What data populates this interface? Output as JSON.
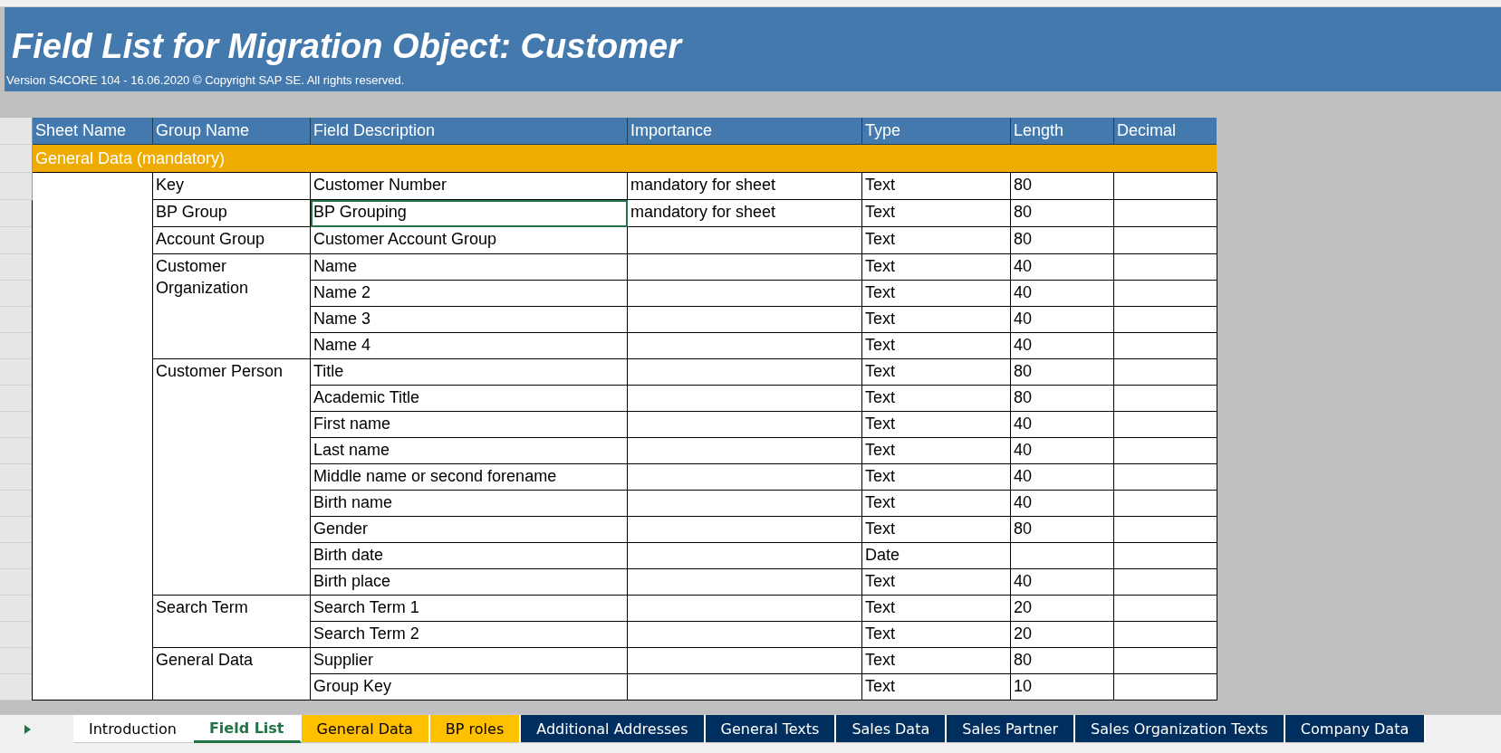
{
  "title": "Field List for Migration Object: Customer",
  "subtitle": "Version S4CORE 104  - 16.06.2020 © Copyright SAP SE. All rights reserved.",
  "columns": [
    "Sheet Name",
    "Group Name",
    "Field Description",
    "Importance",
    "Type",
    "Length",
    "Decimal"
  ],
  "section": "General Data (mandatory)",
  "groups": [
    {
      "name": "Key",
      "fields": [
        {
          "description": "Customer Number",
          "importance": "mandatory for sheet",
          "type": "Text",
          "length": "80",
          "selected": false
        }
      ]
    },
    {
      "name": "BP Group",
      "fields": [
        {
          "description": "BP Grouping",
          "importance": "mandatory for sheet",
          "type": "Text",
          "length": "80",
          "selected": true
        }
      ]
    },
    {
      "name": "Account Group",
      "fields": [
        {
          "description": "Customer Account Group",
          "type": "Text",
          "length": "80",
          "selected": false
        }
      ]
    },
    {
      "name": "Customer Organization",
      "fields": [
        {
          "description": "Name",
          "type": "Text",
          "length": "40",
          "selected": false
        },
        {
          "description": "Name 2",
          "type": "Text",
          "length": "40",
          "selected": false
        },
        {
          "description": "Name 3",
          "type": "Text",
          "length": "40",
          "selected": false
        },
        {
          "description": "Name 4",
          "type": "Text",
          "length": "40",
          "selected": false
        }
      ]
    },
    {
      "name": "Customer Person",
      "fields": [
        {
          "description": "Title",
          "type": "Text",
          "length": "80",
          "selected": false
        },
        {
          "description": "Academic Title",
          "type": "Text",
          "length": "80",
          "selected": false
        },
        {
          "description": "First name",
          "type": "Text",
          "length": "40",
          "selected": false
        },
        {
          "description": "Last name",
          "type": "Text",
          "length": "40",
          "selected": false
        },
        {
          "description": "Middle name or second forename",
          "type": "Text",
          "length": "40",
          "selected": false
        },
        {
          "description": "Birth name",
          "type": "Text",
          "length": "40",
          "selected": false
        },
        {
          "description": "Gender",
          "type": "Text",
          "length": "80",
          "selected": false
        },
        {
          "description": "Birth date",
          "type": "Date",
          "selected": false
        },
        {
          "description": "Birth place",
          "type": "Text",
          "length": "40",
          "selected": false
        }
      ]
    },
    {
      "name": "Search Term",
      "fields": [
        {
          "description": "Search Term 1",
          "type": "Text",
          "length": "20",
          "selected": false
        },
        {
          "description": "Search Term 2",
          "type": "Text",
          "length": "20",
          "selected": false
        }
      ]
    },
    {
      "name": "General Data",
      "fields": [
        {
          "description": "Supplier",
          "type": "Text",
          "length": "80",
          "selected": false
        },
        {
          "description": "Group Key",
          "type": "Text",
          "length": "10",
          "selected": false
        }
      ]
    }
  ],
  "sheet_tabs": [
    {
      "label": "Introduction",
      "selected": false,
      "color": "#ffffff"
    },
    {
      "label": "Field List",
      "selected": true,
      "color": "#ffffff"
    },
    {
      "label": "General Data",
      "selected": false,
      "color": "#ffc000"
    },
    {
      "label": "BP roles",
      "selected": false,
      "color": "#ffc000"
    },
    {
      "label": "Additional Addresses",
      "selected": false,
      "color": "#002f5f"
    },
    {
      "label": "General Texts",
      "selected": false,
      "color": "#002f5f"
    },
    {
      "label": "Sales Data",
      "selected": false,
      "color": "#002f5f"
    },
    {
      "label": "Sales Partner",
      "selected": false,
      "color": "#002f5f"
    },
    {
      "label": "Sales Organization Texts",
      "selected": false,
      "color": "#002f5f"
    },
    {
      "label": "Company Data",
      "selected": false,
      "color": "#002f5f"
    }
  ]
}
